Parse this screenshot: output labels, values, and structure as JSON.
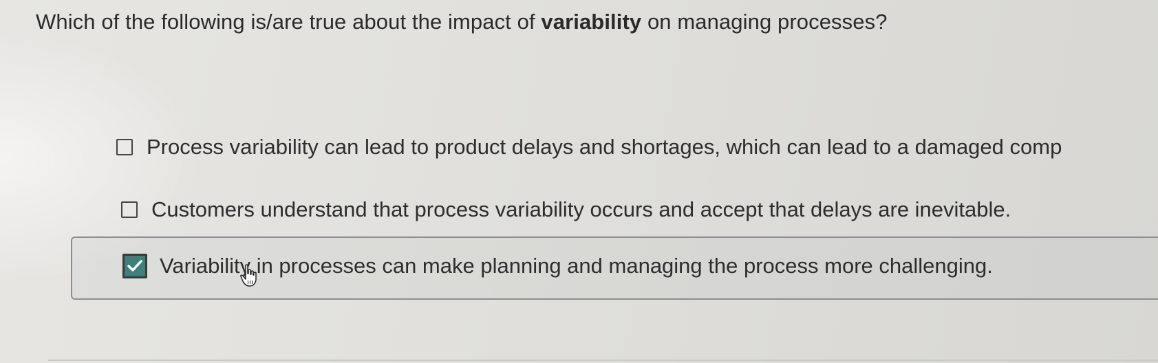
{
  "question": {
    "text_before": "Which of the following is/are true about the impact of ",
    "text_bold": "variability",
    "text_after": " on managing processes?"
  },
  "options": [
    {
      "label": "Process variability can lead to product delays and shortages, which can lead to a damaged comp",
      "checked": false
    },
    {
      "label": "Customers understand that process variability occurs and accept that delays are inevitable.",
      "checked": false
    },
    {
      "label": "Variability in processes can make planning and managing the process more challenging.",
      "checked": true
    }
  ],
  "icons": {
    "checkmark": "check-icon",
    "cursor": "hand-pointer-cursor-icon"
  },
  "colors": {
    "checked_fill": "#3d7f7a",
    "selection_border": "#8e8e8e"
  }
}
